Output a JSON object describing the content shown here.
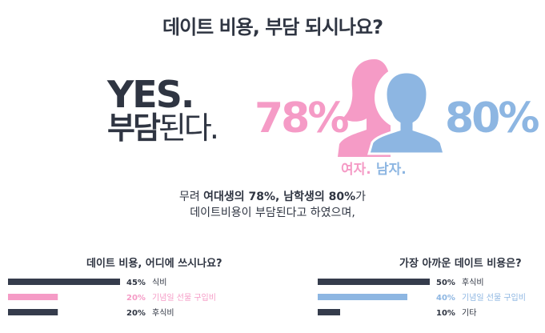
{
  "title": "데이트 비용, 부담 되시나요?",
  "headline": {
    "yes": "YES.",
    "burden_bold": "부담",
    "burden_rest": "된다."
  },
  "female": {
    "percent": "78%",
    "label": "여자."
  },
  "male": {
    "percent": "80%",
    "label": "남자."
  },
  "description": {
    "prefix": "무려 ",
    "female_group": "여대생의 78%, 남학생의 80%",
    "suffix": "가",
    "line2": "데이트비용이 부담된다고 하였으며,"
  },
  "colors": {
    "dark": "#353c4c",
    "pink": "#f59bc6",
    "blue": "#8db6e2",
    "text": "#2f3542"
  },
  "chart_data": [
    {
      "type": "bar",
      "title": "데이트 비용, 어디에 쓰시나요?",
      "categories": [
        "식비",
        "기념일 선물 구입비",
        "후식비"
      ],
      "values": [
        45,
        20,
        20
      ],
      "value_labels": [
        "45%",
        "20%",
        "20%"
      ],
      "highlight": [
        false,
        true,
        false
      ]
    },
    {
      "type": "bar",
      "title": "가장 아까운 데이트 비용은?",
      "categories": [
        "후식비",
        "기념일 선물 구입비",
        "기타"
      ],
      "values": [
        50,
        40,
        10
      ],
      "value_labels": [
        "50%",
        "40%",
        "10%"
      ],
      "highlight": [
        false,
        true,
        false
      ]
    }
  ]
}
